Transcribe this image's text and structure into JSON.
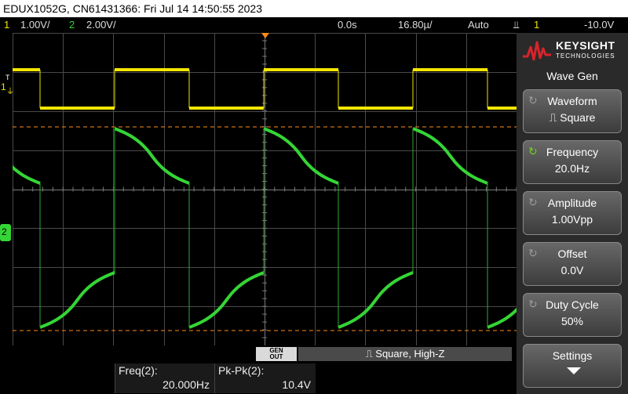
{
  "header": {
    "title": "EDUX1052G, CN61431366: Fri Jul 14 14:50:55 2023"
  },
  "status": {
    "ch1_num": "1",
    "ch1_scale": "1.00V/",
    "ch2_num": "2",
    "ch2_scale": "2.00V/",
    "delay": "0.0s",
    "timebase": "16.80µ/",
    "mode": "Auto",
    "trigger_icon": "rising-edge-trigger",
    "trigger_num": "1",
    "trigger_level": "-10.0V"
  },
  "markers": {
    "ground_t": "T",
    "ch1_marker": "1",
    "ch2_marker": "2"
  },
  "colors": {
    "ch1": "#f2e600",
    "ch2": "#35d535",
    "trigger_marker": "#ff8c1a",
    "cursor_line": "#ff8c1a",
    "logo_red": "#d8232a",
    "grid": "#5a5a5a"
  },
  "logo": {
    "brand": "KEYSIGHT",
    "sub": "TECHNOLOGIES"
  },
  "softkeys": {
    "menu_title": "Wave Gen",
    "waveform": {
      "label": "Waveform",
      "value": "⎍ Square",
      "icon": "rotate-knob-icon"
    },
    "frequency": {
      "label": "Frequency",
      "value": "20.0Hz",
      "icon": "active-knob-icon"
    },
    "amplitude": {
      "label": "Amplitude",
      "value": "1.00Vpp",
      "icon": "rotate-knob-icon"
    },
    "offset": {
      "label": "Offset",
      "value": "0.0V",
      "icon": "rotate-knob-icon"
    },
    "duty": {
      "label": "Duty Cycle",
      "value": "50%",
      "icon": "rotate-knob-icon"
    },
    "settings": {
      "label": "Settings",
      "icon": "down-arrow-icon"
    }
  },
  "genout": {
    "label_line1": "GEN",
    "label_line2": "OUT",
    "value": "⎍ Square, High-Z"
  },
  "measurements": {
    "freq_label": "Freq(2):",
    "freq_value": "20.000Hz",
    "pkpk_label": "Pk-Pk(2):",
    "pkpk_value": "10.4V"
  }
}
